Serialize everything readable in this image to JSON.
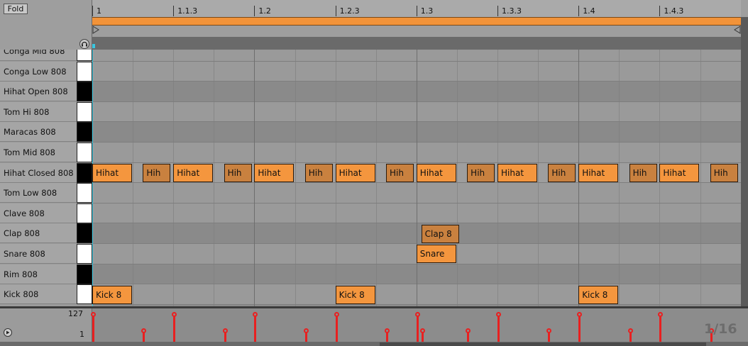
{
  "header": {
    "fold_label": "Fold",
    "beat_labels": [
      "1",
      "1.1.3",
      "1.2",
      "1.2.3",
      "1.3",
      "1.3.3",
      "1.4",
      "1.4.3"
    ]
  },
  "rows": [
    {
      "label": "Conga Mid 808",
      "key": "white"
    },
    {
      "label": "Conga Low 808",
      "key": "white"
    },
    {
      "label": "Hihat Open 808",
      "key": "black"
    },
    {
      "label": "Tom Hi 808",
      "key": "white"
    },
    {
      "label": "Maracas 808",
      "key": "black"
    },
    {
      "label": "Tom Mid 808",
      "key": "white"
    },
    {
      "label": "Hihat Closed 808",
      "key": "black"
    },
    {
      "label": "Tom Low 808",
      "key": "white"
    },
    {
      "label": "Clave 808",
      "key": "white"
    },
    {
      "label": "Clap 808",
      "key": "black"
    },
    {
      "label": "Snare 808",
      "key": "white"
    },
    {
      "label": "Rim 808",
      "key": "black"
    },
    {
      "label": "Kick 808",
      "key": "white"
    }
  ],
  "notes": [
    {
      "row": 6,
      "step": 0,
      "len": 1,
      "label": "Hihat",
      "style": "bright"
    },
    {
      "row": 6,
      "step": 1.25,
      "len": 0.7,
      "label": "Hih",
      "style": "dim"
    },
    {
      "row": 6,
      "step": 2,
      "len": 1,
      "label": "Hihat",
      "style": "bright"
    },
    {
      "row": 6,
      "step": 3.25,
      "len": 0.7,
      "label": "Hih",
      "style": "dim"
    },
    {
      "row": 6,
      "step": 4,
      "len": 1,
      "label": "Hihat",
      "style": "bright"
    },
    {
      "row": 6,
      "step": 5.25,
      "len": 0.7,
      "label": "Hih",
      "style": "dim"
    },
    {
      "row": 6,
      "step": 6,
      "len": 1,
      "label": "Hihat",
      "style": "bright"
    },
    {
      "row": 6,
      "step": 7.25,
      "len": 0.7,
      "label": "Hih",
      "style": "dim"
    },
    {
      "row": 6,
      "step": 8,
      "len": 1,
      "label": "Hihat",
      "style": "bright"
    },
    {
      "row": 6,
      "step": 9.25,
      "len": 0.7,
      "label": "Hih",
      "style": "dim"
    },
    {
      "row": 6,
      "step": 10,
      "len": 1,
      "label": "Hihat",
      "style": "bright"
    },
    {
      "row": 6,
      "step": 11.25,
      "len": 0.7,
      "label": "Hih",
      "style": "dim"
    },
    {
      "row": 6,
      "step": 12,
      "len": 1,
      "label": "Hihat",
      "style": "bright"
    },
    {
      "row": 6,
      "step": 13.25,
      "len": 0.7,
      "label": "Hih",
      "style": "dim"
    },
    {
      "row": 6,
      "step": 14,
      "len": 1,
      "label": "Hihat",
      "style": "bright"
    },
    {
      "row": 6,
      "step": 15.25,
      "len": 0.7,
      "label": "Hih",
      "style": "dim"
    },
    {
      "row": 9,
      "step": 8.12,
      "len": 0.95,
      "label": "Clap 8",
      "style": "dim"
    },
    {
      "row": 10,
      "step": 8,
      "len": 1,
      "label": "Snare",
      "style": "bright"
    },
    {
      "row": 12,
      "step": 0,
      "len": 1,
      "label": "Kick 8",
      "style": "bright"
    },
    {
      "row": 12,
      "step": 6,
      "len": 1,
      "label": "Kick 8",
      "style": "bright"
    },
    {
      "row": 12,
      "step": 12,
      "len": 1,
      "label": "Kick 8",
      "style": "bright"
    }
  ],
  "velocity": {
    "max_label": "127",
    "min_label": "1",
    "stems": [
      {
        "step": 0,
        "level": 1.0
      },
      {
        "step": 1.25,
        "level": 0.35
      },
      {
        "step": 2,
        "level": 1.0
      },
      {
        "step": 3.25,
        "level": 0.35
      },
      {
        "step": 4,
        "level": 1.0
      },
      {
        "step": 5.25,
        "level": 0.35
      },
      {
        "step": 6,
        "level": 1.0
      },
      {
        "step": 7.25,
        "level": 0.35
      },
      {
        "step": 8,
        "level": 1.0
      },
      {
        "step": 8.12,
        "level": 0.35
      },
      {
        "step": 9.25,
        "level": 0.35
      },
      {
        "step": 10,
        "level": 1.0
      },
      {
        "step": 11.25,
        "level": 0.35
      },
      {
        "step": 12,
        "level": 1.0
      },
      {
        "step": 13.25,
        "level": 0.35
      },
      {
        "step": 14,
        "level": 1.0
      },
      {
        "step": 15.25,
        "level": 0.35
      }
    ]
  },
  "grid_resolution": "1/16",
  "colors": {
    "note_bright": "#f4963e",
    "note_dim": "#c9813f",
    "loop_bar": "#f29339",
    "velocity_stem": "#e82020",
    "playhead": "#39c7e0"
  }
}
